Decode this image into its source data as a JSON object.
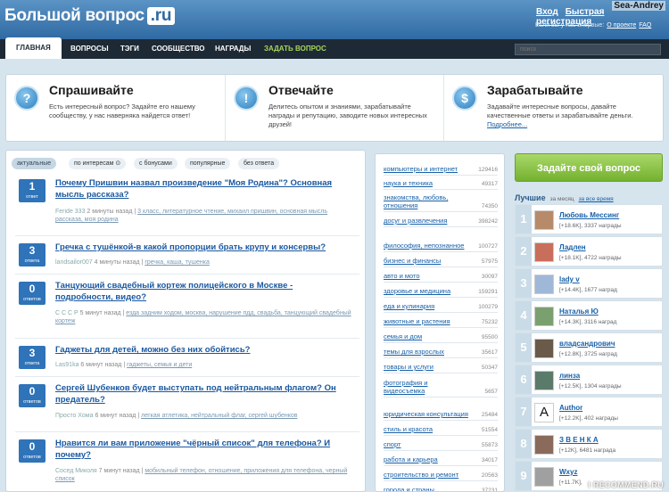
{
  "header": {
    "logo_text": "Большой вопрос",
    "logo_ru": ".ru",
    "username_overlay": "Sea-Andrey",
    "login": "Вход",
    "register": "Быстрая регистрация",
    "auth_note": "Если вы у нас впервые:",
    "about_link": "О проекте",
    "faq_link": "FAQ"
  },
  "nav": {
    "items": [
      "ГЛАВНАЯ",
      "ВОПРОСЫ",
      "ТЭГИ",
      "СООБЩЕСТВО",
      "НАГРАДЫ",
      "ЗАДАТЬ ВОПРОС"
    ],
    "search_placeholder": "поиск"
  },
  "intro": [
    {
      "icon": "question-icon",
      "glyph": "?",
      "title": "Спрашивайте",
      "text": "Есть интересный вопрос? Задайте его нашему сообществу, у нас наверняка найдется ответ!"
    },
    {
      "icon": "exclamation-icon",
      "glyph": "!",
      "title": "Отвечайте",
      "text": "Делитесь опытом и знаниями, зарабатывайте награды и репутацию, заводите новых интересных друзей!"
    },
    {
      "icon": "dollar-icon",
      "glyph": "$",
      "title": "Зарабатывайте",
      "text": "Задавайте интересные вопросы, давайте качественные ответы и зарабатывайте деньги.",
      "link": "Подробнее..."
    }
  ],
  "filters": [
    "актуальные",
    "по интересам ⊙",
    "с бонусами",
    "популярные",
    "без ответа"
  ],
  "questions": [
    {
      "count": "1",
      "count_label": "ответ",
      "title": "Почему Пришвин назвал произведение \"Моя Родина\"? Основная мысль рассказа?",
      "author": "Feride 333",
      "time": "2 минуты назад",
      "tags": "3 класс, литературное чтение, михаил пришвин, основная мысль рассказа, моя родина"
    },
    {
      "count": "3",
      "count_label": "ответа",
      "title": "Гречка с тушёнкой-в какой пропорции брать крупу и консервы?",
      "author": "landsailor007",
      "time": "4 минуты назад",
      "tags": "гречка, каша, тушенка"
    },
    {
      "count": "0",
      "count_label": "ответов",
      "title": "Танцующий свадебный кортеж полицейского в Москве - подробности, видео?",
      "author": "С С С Р",
      "time": "5 минут назад",
      "tags": "езда задним ходом, москва, нарушение пдд, свадьба, танцующий свадебный кортеж"
    },
    {
      "count": "3",
      "count_label": "ответа",
      "title": "Гаджеты для детей, можно без них обойтись?",
      "author": "Las91ka",
      "time": "6 минут назад",
      "tags": "гаджеты, семья и дети"
    },
    {
      "count": "0",
      "count_label": "ответов",
      "title": "Сергей Шубенков будет выступать под нейтральным флагом? Он предатель?",
      "author": "Просто Хома",
      "time": "6 минут назад",
      "tags": "легкая атлетика, нейтральный флаг, сергей шубенков"
    },
    {
      "count": "0",
      "count_label": "ответов",
      "title": "Нравится ли вам приложение \"чёрный список\" для телефона? И почему?",
      "author": "Сосед Миколя",
      "time": "7 минут назад",
      "tags": "мобильный телефон, отношение, приложения для телефона, черный список"
    }
  ],
  "categories": [
    {
      "name": "компьютеры и интернет",
      "count": "129416"
    },
    {
      "name": "наука и техника",
      "count": "49317"
    },
    {
      "name": "знакомства, любовь, отношения",
      "count": "74350"
    },
    {
      "name": "досуг и развлечения",
      "count": "398242"
    },
    {
      "name": "философия, непознанное",
      "count": "100727"
    },
    {
      "name": "бизнес и финансы",
      "count": "57975"
    },
    {
      "name": "авто и мото",
      "count": "30097"
    },
    {
      "name": "здоровье и медицина",
      "count": "159291"
    },
    {
      "name": "еда и кулинария",
      "count": "100279"
    },
    {
      "name": "животные и растения",
      "count": "75232"
    },
    {
      "name": "семья и дом",
      "count": "95500"
    },
    {
      "name": "темы для взрослых",
      "count": "35617"
    },
    {
      "name": "товары и услуги",
      "count": "50347"
    },
    {
      "name": "фотография и видеосъемка",
      "count": "5657"
    },
    {
      "name": "юридическая консультация",
      "count": "25484"
    },
    {
      "name": "стиль и красота",
      "count": "51554"
    },
    {
      "name": "спорт",
      "count": "55873"
    },
    {
      "name": "работа и карьера",
      "count": "34017"
    },
    {
      "name": "строительство и ремонт",
      "count": "20563"
    },
    {
      "name": "города и страны",
      "count": "37231"
    }
  ],
  "sidebar": {
    "ask_button": "Задайте свой вопрос",
    "best_title": "Лучшие",
    "best_period": "за месяц",
    "best_all": "за все время",
    "leaders": [
      {
        "rank": "1",
        "name": "Любовь Мессинг",
        "rep": "[+18.6K]",
        "awards": "3337 награды",
        "avatar_color": "#b78a6a"
      },
      {
        "rank": "2",
        "name": "Ладлен",
        "rep": "[+18.1K]",
        "awards": "4722 награды",
        "avatar_color": "#c96e5a"
      },
      {
        "rank": "3",
        "name": "lady v",
        "rep": "[+14.4K]",
        "awards": "1677 наград",
        "avatar_color": "#9fb8d8"
      },
      {
        "rank": "4",
        "name": "Наталья Ю",
        "rep": "[+14.3K]",
        "awards": "3116 наград",
        "avatar_color": "#7aa070"
      },
      {
        "rank": "5",
        "name": "владсандрович",
        "rep": "[+12.8K]",
        "awards": "3725 наград",
        "avatar_color": "#6a5a4a"
      },
      {
        "rank": "6",
        "name": "линза",
        "rep": "[+12.5K]",
        "awards": "1304 награды",
        "avatar_color": "#5a7a6a"
      },
      {
        "rank": "7",
        "name": "Author",
        "rep": "[+12.2K]",
        "awards": "402 награды",
        "avatar_letter": "A",
        "avatar_color": "#ffffff"
      },
      {
        "rank": "8",
        "name": "З В Е Н К А",
        "rep": "[+12K]",
        "awards": "6481 награда",
        "avatar_color": "#8a6a5a"
      },
      {
        "rank": "9",
        "name": "Wxyz",
        "rep": "[+11.7K]",
        "awards": "",
        "avatar_color": "#a0a0a0"
      }
    ]
  },
  "watermark": "I RECOMMEND.RU",
  "colors": {
    "brand": "#2f6aa3",
    "nav": "#1d2a36",
    "accent_green": "#74b12e",
    "link": "#1760a8"
  }
}
